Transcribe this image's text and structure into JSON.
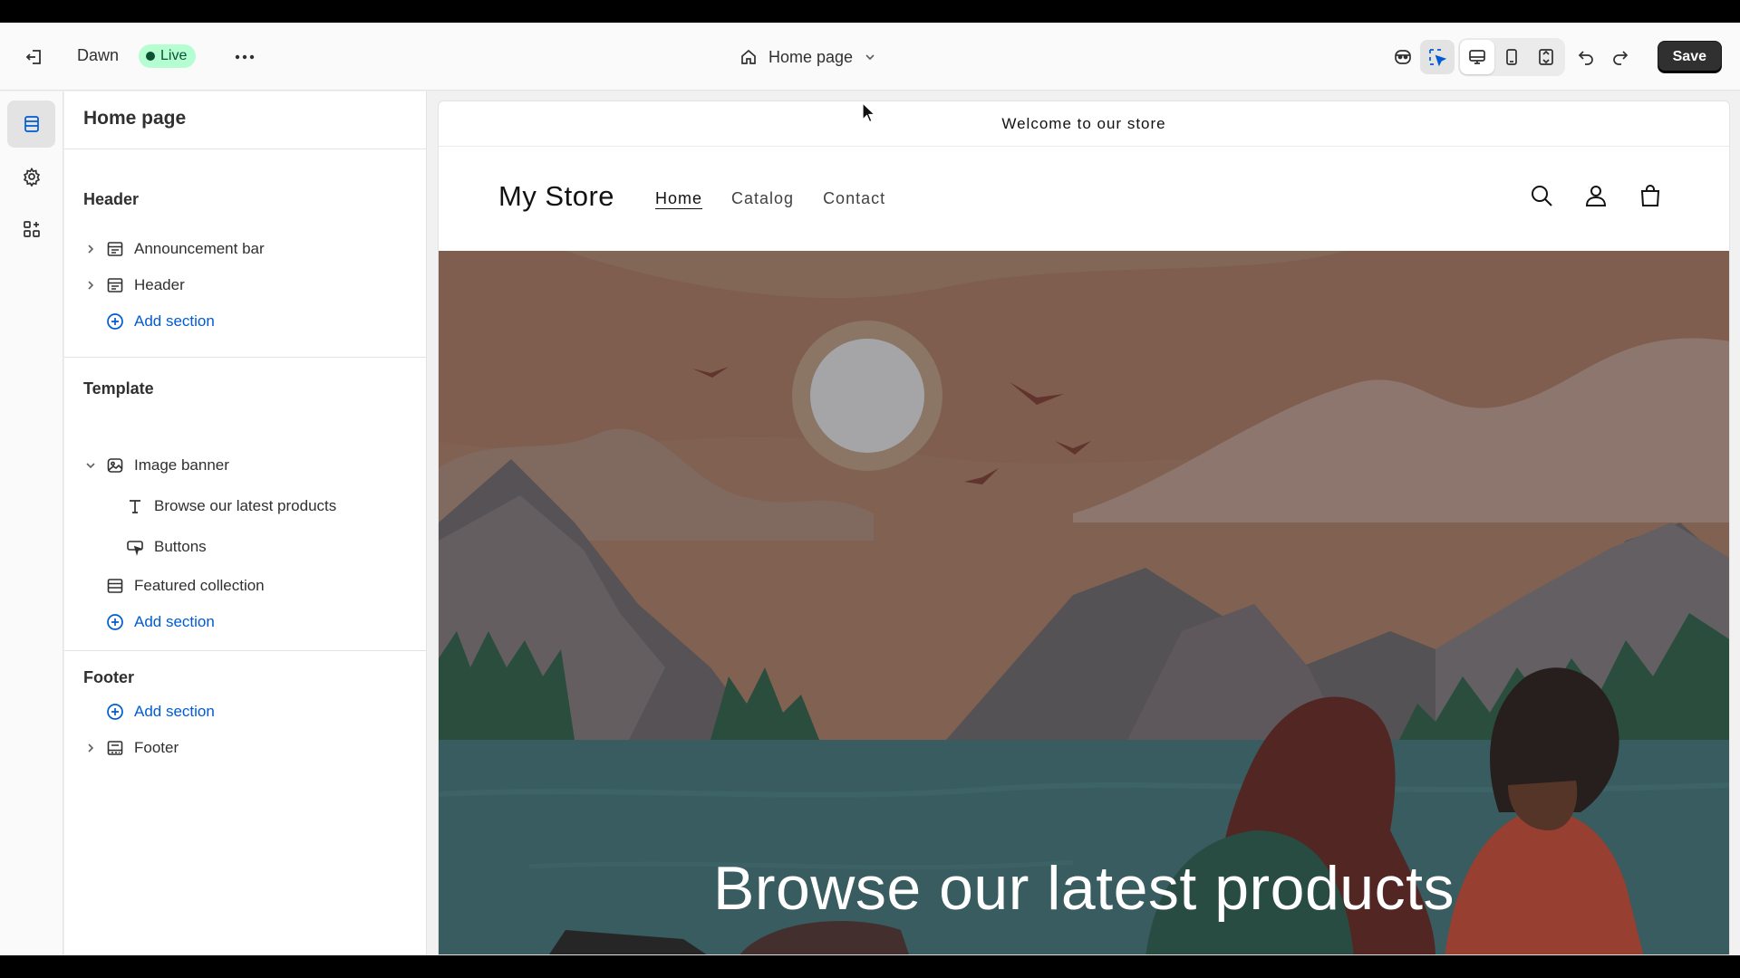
{
  "topbar": {
    "theme_name": "Dawn",
    "live_badge": "Live",
    "page_selector": "Home page",
    "save_label": "Save"
  },
  "sidebar": {
    "title": "Home page",
    "groups": [
      {
        "label": "Header",
        "rows": [
          {
            "label": "Announcement bar",
            "icon": "section-icon"
          },
          {
            "label": "Header",
            "icon": "section-icon"
          },
          {
            "label": "Add section",
            "icon": "plus-circle-icon"
          }
        ]
      },
      {
        "label": "Template",
        "rows": [
          {
            "label": "Image banner",
            "icon": "image-icon"
          },
          {
            "label": "Browse our latest products",
            "icon": "text-icon"
          },
          {
            "label": "Buttons",
            "icon": "button-icon"
          },
          {
            "label": "Featured collection",
            "icon": "section-icon"
          },
          {
            "label": "Add section",
            "icon": "plus-circle-icon"
          }
        ]
      },
      {
        "label": "Footer",
        "rows": [
          {
            "label": "Add section",
            "icon": "plus-circle-icon"
          },
          {
            "label": "Footer",
            "icon": "footer-icon"
          }
        ]
      }
    ]
  },
  "preview": {
    "announcement": "Welcome to our store",
    "store_name": "My Store",
    "nav": [
      "Home",
      "Catalog",
      "Contact"
    ],
    "banner_heading": "Browse our latest products"
  },
  "colors": {
    "accent": "#005bd3",
    "live_bg": "#b4fed2",
    "live_text": "#0c5132",
    "save_bg": "#303030"
  }
}
